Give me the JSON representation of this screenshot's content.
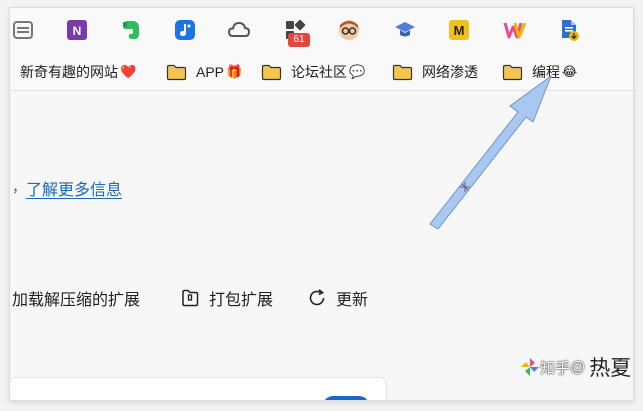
{
  "toolbar": {
    "extensions": [
      {
        "icon": "menu-icon"
      },
      {
        "icon": "onenote-icon",
        "color": "#7a3aa8",
        "label": "N"
      },
      {
        "icon": "evernote-icon",
        "color": "#2dbe60"
      },
      {
        "icon": "music-icon",
        "color": "#1a74e8",
        "label": "♪"
      },
      {
        "icon": "cloud-icon"
      },
      {
        "icon": "extension-puzzle-icon",
        "badge": "61"
      },
      {
        "icon": "avatar-icon"
      },
      {
        "icon": "graduation-cap-icon",
        "color": "#4f7fd6"
      },
      {
        "icon": "m-logo-icon",
        "color": "#f2c01c",
        "label": "M"
      },
      {
        "icon": "w-logo-icon",
        "label": "W"
      },
      {
        "icon": "document-download-icon",
        "color": "#2f6fd1"
      }
    ]
  },
  "bookmarks": [
    {
      "label": "新奇有趣的网站",
      "emoji": "❤️",
      "folder": false
    },
    {
      "label": "APP",
      "emoji": "🎁",
      "folder": true
    },
    {
      "label": "论坛社区",
      "emoji": "💬",
      "folder": true
    },
    {
      "label": "网络渗透",
      "emoji": "",
      "folder": true
    },
    {
      "label": "编程",
      "emoji": "😂",
      "folder": true
    }
  ],
  "main": {
    "prefix": "，",
    "learn_more": "了解更多信息",
    "actions": {
      "load_unpacked": "加载解压缩的扩展",
      "pack": "打包扩展",
      "update": "更新"
    }
  },
  "watermark": {
    "site": "知乎",
    "separator": "@",
    "name": "热夏"
  },
  "colors": {
    "link": "#1a6ab5",
    "toggle": "#1b67c7",
    "arrow": "#a8c8f0",
    "folder": "#f6c64c"
  }
}
